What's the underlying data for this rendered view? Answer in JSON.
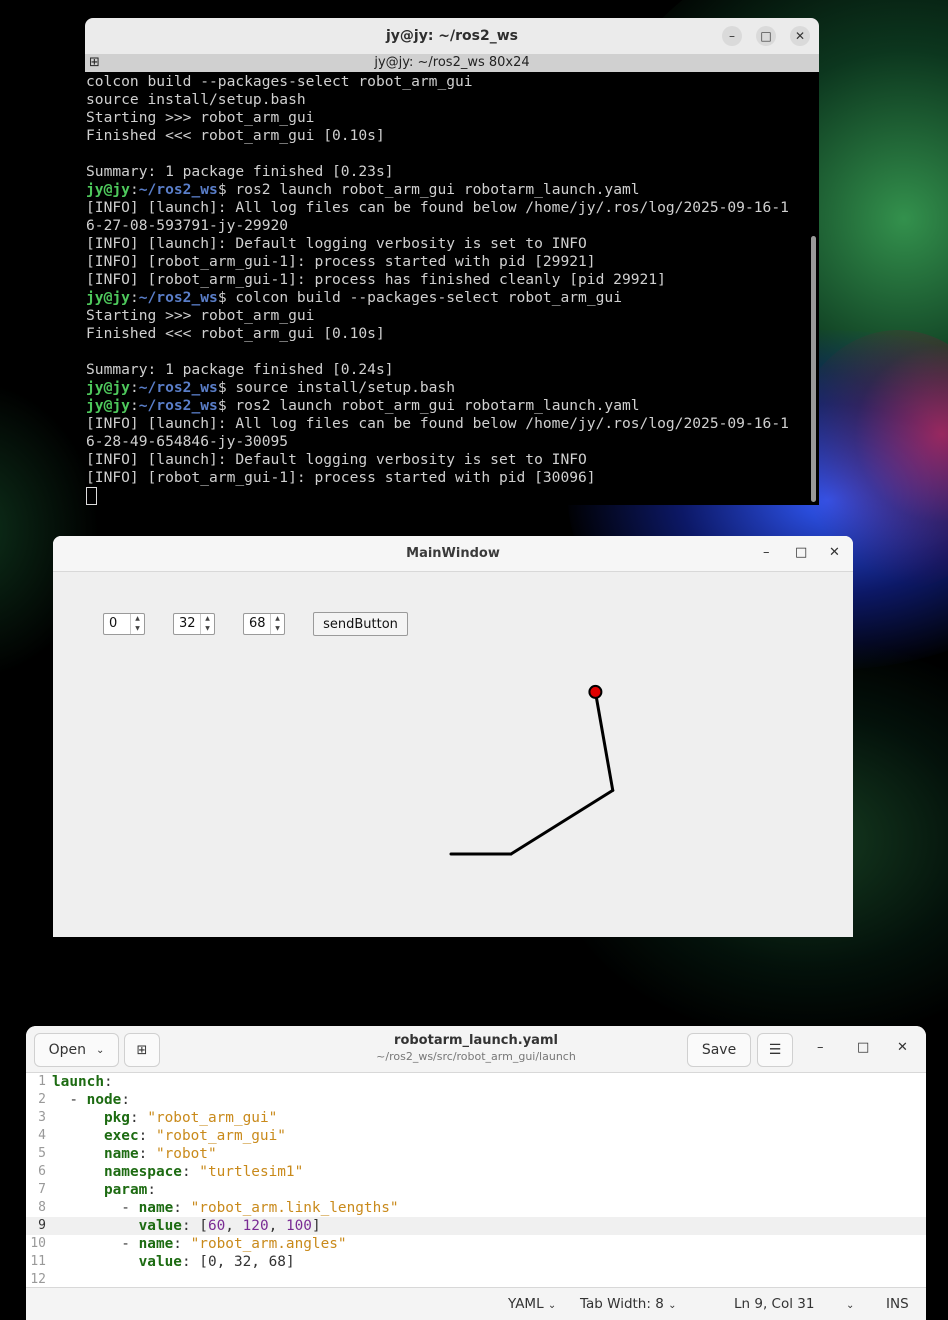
{
  "terminal": {
    "title": "jy@jy: ~/ros2_ws",
    "tab_label": "jy@jy: ~/ros2_ws 80x24",
    "prompt_user": "jy@jy",
    "prompt_sep": ":",
    "prompt_path": "~/ros2_ws",
    "prompt_sign": "$ ",
    "lines": [
      {
        "type": "out",
        "text": "colcon build --packages-select robot_arm_gui"
      },
      {
        "type": "out",
        "text": "source install/setup.bash"
      },
      {
        "type": "out",
        "text": "Starting >>> robot_arm_gui"
      },
      {
        "type": "out",
        "text": "Finished <<< robot_arm_gui [0.10s]"
      },
      {
        "type": "out",
        "text": ""
      },
      {
        "type": "out",
        "text": "Summary: 1 package finished [0.23s]"
      },
      {
        "type": "cmd",
        "text": "ros2 launch robot_arm_gui robotarm_launch.yaml"
      },
      {
        "type": "out",
        "text": "[INFO] [launch]: All log files can be found below /home/jy/.ros/log/2025-09-16-1"
      },
      {
        "type": "out",
        "text": "6-27-08-593791-jy-29920"
      },
      {
        "type": "out",
        "text": "[INFO] [launch]: Default logging verbosity is set to INFO"
      },
      {
        "type": "out",
        "text": "[INFO] [robot_arm_gui-1]: process started with pid [29921]"
      },
      {
        "type": "out",
        "text": "[INFO] [robot_arm_gui-1]: process has finished cleanly [pid 29921]"
      },
      {
        "type": "cmd",
        "text": "colcon build --packages-select robot_arm_gui"
      },
      {
        "type": "out",
        "text": "Starting >>> robot_arm_gui"
      },
      {
        "type": "out",
        "text": "Finished <<< robot_arm_gui [0.10s]"
      },
      {
        "type": "out",
        "text": ""
      },
      {
        "type": "out",
        "text": "Summary: 1 package finished [0.24s]"
      },
      {
        "type": "cmd",
        "text": "source install/setup.bash"
      },
      {
        "type": "cmd",
        "text": "ros2 launch robot_arm_gui robotarm_launch.yaml"
      },
      {
        "type": "out",
        "text": "[INFO] [launch]: All log files can be found below /home/jy/.ros/log/2025-09-16-1"
      },
      {
        "type": "out",
        "text": "6-28-49-654846-jy-30095"
      },
      {
        "type": "out",
        "text": "[INFO] [launch]: Default logging verbosity is set to INFO"
      },
      {
        "type": "out",
        "text": "[INFO] [robot_arm_gui-1]: process started with pid [30096]"
      }
    ]
  },
  "mainwindow": {
    "title": "MainWindow",
    "spin1_value": "0",
    "spin2_value": "32",
    "spin3_value": "68",
    "send_label": "sendButton",
    "arm": {
      "link_lengths": [
        60,
        120,
        100
      ],
      "angles_deg": [
        0,
        32,
        68
      ],
      "link_color": "#000000",
      "end_effector_color": "#e00000"
    }
  },
  "editor": {
    "open_label": "Open",
    "title": "robotarm_launch.yaml",
    "path": "~/ros2_ws/src/robot_arm_gui/launch",
    "save_label": "Save",
    "status": {
      "language": "YAML",
      "tab_width": "Tab Width: 8",
      "position": "Ln 9, Col 31",
      "mode": "INS"
    },
    "current_line": 9,
    "lines": [
      [
        {
          "c": "k",
          "t": "launch"
        },
        {
          "c": "",
          "t": ":"
        }
      ],
      [
        {
          "c": "",
          "t": "  - "
        },
        {
          "c": "k",
          "t": "node"
        },
        {
          "c": "",
          "t": ":"
        }
      ],
      [
        {
          "c": "",
          "t": "      "
        },
        {
          "c": "k",
          "t": "pkg"
        },
        {
          "c": "",
          "t": ": "
        },
        {
          "c": "s",
          "t": "\"robot_arm_gui\""
        }
      ],
      [
        {
          "c": "",
          "t": "      "
        },
        {
          "c": "k",
          "t": "exec"
        },
        {
          "c": "",
          "t": ": "
        },
        {
          "c": "s",
          "t": "\"robot_arm_gui\""
        }
      ],
      [
        {
          "c": "",
          "t": "      "
        },
        {
          "c": "k",
          "t": "name"
        },
        {
          "c": "",
          "t": ": "
        },
        {
          "c": "s",
          "t": "\"robot\""
        }
      ],
      [
        {
          "c": "",
          "t": "      "
        },
        {
          "c": "k",
          "t": "namespace"
        },
        {
          "c": "",
          "t": ": "
        },
        {
          "c": "s",
          "t": "\"turtlesim1\""
        }
      ],
      [
        {
          "c": "",
          "t": "      "
        },
        {
          "c": "k",
          "t": "param"
        },
        {
          "c": "",
          "t": ":"
        }
      ],
      [
        {
          "c": "",
          "t": "        - "
        },
        {
          "c": "k",
          "t": "name"
        },
        {
          "c": "",
          "t": ": "
        },
        {
          "c": "s",
          "t": "\"robot_arm.link_lengths\""
        }
      ],
      [
        {
          "c": "",
          "t": "          "
        },
        {
          "c": "k",
          "t": "value"
        },
        {
          "c": "",
          "t": ": ["
        },
        {
          "c": "n",
          "t": "60"
        },
        {
          "c": "",
          "t": ", "
        },
        {
          "c": "n",
          "t": "120"
        },
        {
          "c": "",
          "t": ", "
        },
        {
          "c": "n",
          "t": "100"
        },
        {
          "c": "",
          "t": "]"
        }
      ],
      [
        {
          "c": "",
          "t": "        - "
        },
        {
          "c": "k",
          "t": "name"
        },
        {
          "c": "",
          "t": ": "
        },
        {
          "c": "s",
          "t": "\"robot_arm.angles\""
        }
      ],
      [
        {
          "c": "",
          "t": "          "
        },
        {
          "c": "k",
          "t": "value"
        },
        {
          "c": "",
          "t": ": ["
        },
        {
          "c": "",
          "t": "0"
        },
        {
          "c": "",
          "t": ", "
        },
        {
          "c": "",
          "t": "32"
        },
        {
          "c": "",
          "t": ", "
        },
        {
          "c": "",
          "t": "68"
        },
        {
          "c": "",
          "t": "]"
        }
      ],
      []
    ]
  }
}
